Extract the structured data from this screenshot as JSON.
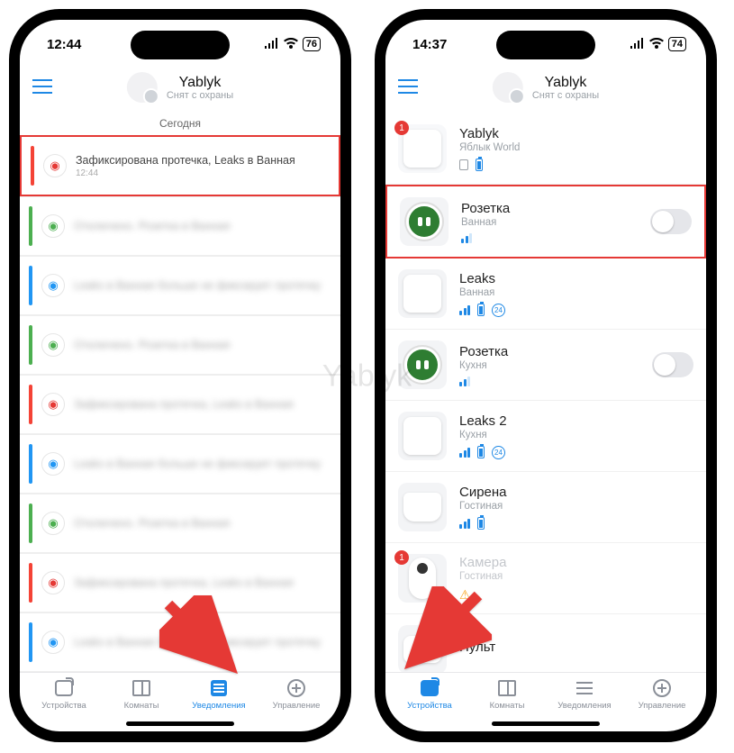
{
  "watermark": "Yablyk",
  "left": {
    "status": {
      "time": "12:44",
      "battery": "76"
    },
    "header": {
      "title": "Yablyk",
      "subtitle": "Снят с охраны"
    },
    "date_header": "Сегодня",
    "notifications": [
      {
        "stripe": "red",
        "icon_color": "#e53935",
        "text": "Зафиксирована протечка, Leaks в Ванная",
        "time": "12:44",
        "highlight": true
      },
      {
        "stripe": "green",
        "icon_color": "#4caf50",
        "text": "Отключено. Розетка в Ванная"
      },
      {
        "stripe": "blue",
        "icon_color": "#2196f3",
        "text": "Leaks в Ванная больше не фиксирует протечку"
      },
      {
        "stripe": "green",
        "icon_color": "#4caf50",
        "text": "Отключено. Розетка в Ванная"
      },
      {
        "stripe": "red",
        "icon_color": "#e53935",
        "text": "Зафиксирована протечка, Leaks в Ванная"
      },
      {
        "stripe": "blue",
        "icon_color": "#2196f3",
        "text": "Leaks в Ванная больше не фиксирует протечку"
      },
      {
        "stripe": "green",
        "icon_color": "#4caf50",
        "text": "Отключено. Розетка в Ванная"
      },
      {
        "stripe": "red",
        "icon_color": "#e53935",
        "text": "Зафиксирована протечка, Leaks в Ванная"
      },
      {
        "stripe": "blue",
        "icon_color": "#2196f3",
        "text": "Leaks в Ванная больше не фиксирует протечку"
      }
    ],
    "tabs": {
      "devices": "Устройства",
      "rooms": "Комнаты",
      "notifications": "Уведомления",
      "control": "Управление",
      "active": "notifications"
    }
  },
  "right": {
    "status": {
      "time": "14:37",
      "battery": "74"
    },
    "header": {
      "title": "Yablyk",
      "subtitle": "Снят с охраны"
    },
    "devices": [
      {
        "name": "Yablyk",
        "room": "Яблык World",
        "thumb": "hub",
        "badge": "1",
        "indicators": [
          "sim",
          "batt"
        ]
      },
      {
        "name": "Розетка",
        "room": "Ванная",
        "thumb": "socket",
        "toggle": true,
        "indicators": [
          "signal-dim"
        ],
        "highlight": true
      },
      {
        "name": "Leaks",
        "room": "Ванная",
        "thumb": "white",
        "indicators": [
          "signal",
          "batt",
          "24"
        ]
      },
      {
        "name": "Розетка",
        "room": "Кухня",
        "thumb": "socket",
        "toggle": true,
        "indicators": [
          "signal-dim"
        ]
      },
      {
        "name": "Leaks 2",
        "room": "Кухня",
        "thumb": "white",
        "indicators": [
          "signal",
          "batt",
          "24"
        ]
      },
      {
        "name": "Сирена",
        "room": "Гостиная",
        "thumb": "siren",
        "indicators": [
          "signal",
          "batt"
        ]
      },
      {
        "name": "Камера",
        "room": "Гостиная",
        "thumb": "camera",
        "badge": "1",
        "dim": true,
        "indicators": [
          "warn"
        ]
      },
      {
        "name": "Пульт",
        "room": "",
        "thumb": "keyfob",
        "indicators": []
      }
    ],
    "tabs": {
      "devices": "Устройства",
      "rooms": "Комнаты",
      "notifications": "Уведомления",
      "control": "Управление",
      "active": "devices"
    }
  }
}
